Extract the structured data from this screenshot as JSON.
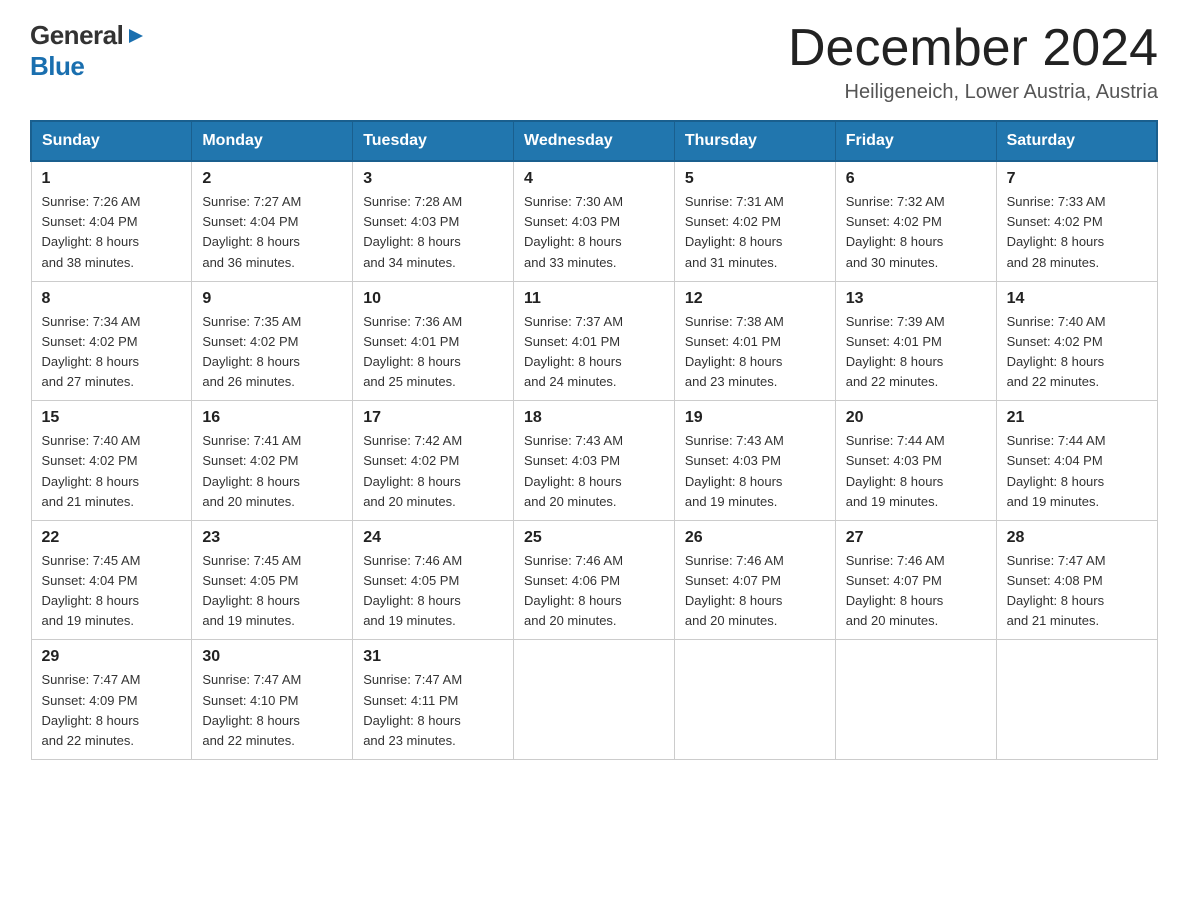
{
  "logo": {
    "general": "General",
    "blue": "Blue"
  },
  "title": {
    "month_year": "December 2024",
    "location": "Heiligeneich, Lower Austria, Austria"
  },
  "weekdays": [
    "Sunday",
    "Monday",
    "Tuesday",
    "Wednesday",
    "Thursday",
    "Friday",
    "Saturday"
  ],
  "weeks": [
    [
      {
        "day": "1",
        "sunrise": "7:26 AM",
        "sunset": "4:04 PM",
        "daylight": "8 hours and 38 minutes."
      },
      {
        "day": "2",
        "sunrise": "7:27 AM",
        "sunset": "4:04 PM",
        "daylight": "8 hours and 36 minutes."
      },
      {
        "day": "3",
        "sunrise": "7:28 AM",
        "sunset": "4:03 PM",
        "daylight": "8 hours and 34 minutes."
      },
      {
        "day": "4",
        "sunrise": "7:30 AM",
        "sunset": "4:03 PM",
        "daylight": "8 hours and 33 minutes."
      },
      {
        "day": "5",
        "sunrise": "7:31 AM",
        "sunset": "4:02 PM",
        "daylight": "8 hours and 31 minutes."
      },
      {
        "day": "6",
        "sunrise": "7:32 AM",
        "sunset": "4:02 PM",
        "daylight": "8 hours and 30 minutes."
      },
      {
        "day": "7",
        "sunrise": "7:33 AM",
        "sunset": "4:02 PM",
        "daylight": "8 hours and 28 minutes."
      }
    ],
    [
      {
        "day": "8",
        "sunrise": "7:34 AM",
        "sunset": "4:02 PM",
        "daylight": "8 hours and 27 minutes."
      },
      {
        "day": "9",
        "sunrise": "7:35 AM",
        "sunset": "4:02 PM",
        "daylight": "8 hours and 26 minutes."
      },
      {
        "day": "10",
        "sunrise": "7:36 AM",
        "sunset": "4:01 PM",
        "daylight": "8 hours and 25 minutes."
      },
      {
        "day": "11",
        "sunrise": "7:37 AM",
        "sunset": "4:01 PM",
        "daylight": "8 hours and 24 minutes."
      },
      {
        "day": "12",
        "sunrise": "7:38 AM",
        "sunset": "4:01 PM",
        "daylight": "8 hours and 23 minutes."
      },
      {
        "day": "13",
        "sunrise": "7:39 AM",
        "sunset": "4:01 PM",
        "daylight": "8 hours and 22 minutes."
      },
      {
        "day": "14",
        "sunrise": "7:40 AM",
        "sunset": "4:02 PM",
        "daylight": "8 hours and 22 minutes."
      }
    ],
    [
      {
        "day": "15",
        "sunrise": "7:40 AM",
        "sunset": "4:02 PM",
        "daylight": "8 hours and 21 minutes."
      },
      {
        "day": "16",
        "sunrise": "7:41 AM",
        "sunset": "4:02 PM",
        "daylight": "8 hours and 20 minutes."
      },
      {
        "day": "17",
        "sunrise": "7:42 AM",
        "sunset": "4:02 PM",
        "daylight": "8 hours and 20 minutes."
      },
      {
        "day": "18",
        "sunrise": "7:43 AM",
        "sunset": "4:03 PM",
        "daylight": "8 hours and 20 minutes."
      },
      {
        "day": "19",
        "sunrise": "7:43 AM",
        "sunset": "4:03 PM",
        "daylight": "8 hours and 19 minutes."
      },
      {
        "day": "20",
        "sunrise": "7:44 AM",
        "sunset": "4:03 PM",
        "daylight": "8 hours and 19 minutes."
      },
      {
        "day": "21",
        "sunrise": "7:44 AM",
        "sunset": "4:04 PM",
        "daylight": "8 hours and 19 minutes."
      }
    ],
    [
      {
        "day": "22",
        "sunrise": "7:45 AM",
        "sunset": "4:04 PM",
        "daylight": "8 hours and 19 minutes."
      },
      {
        "day": "23",
        "sunrise": "7:45 AM",
        "sunset": "4:05 PM",
        "daylight": "8 hours and 19 minutes."
      },
      {
        "day": "24",
        "sunrise": "7:46 AM",
        "sunset": "4:05 PM",
        "daylight": "8 hours and 19 minutes."
      },
      {
        "day": "25",
        "sunrise": "7:46 AM",
        "sunset": "4:06 PM",
        "daylight": "8 hours and 20 minutes."
      },
      {
        "day": "26",
        "sunrise": "7:46 AM",
        "sunset": "4:07 PM",
        "daylight": "8 hours and 20 minutes."
      },
      {
        "day": "27",
        "sunrise": "7:46 AM",
        "sunset": "4:07 PM",
        "daylight": "8 hours and 20 minutes."
      },
      {
        "day": "28",
        "sunrise": "7:47 AM",
        "sunset": "4:08 PM",
        "daylight": "8 hours and 21 minutes."
      }
    ],
    [
      {
        "day": "29",
        "sunrise": "7:47 AM",
        "sunset": "4:09 PM",
        "daylight": "8 hours and 22 minutes."
      },
      {
        "day": "30",
        "sunrise": "7:47 AM",
        "sunset": "4:10 PM",
        "daylight": "8 hours and 22 minutes."
      },
      {
        "day": "31",
        "sunrise": "7:47 AM",
        "sunset": "4:11 PM",
        "daylight": "8 hours and 23 minutes."
      },
      null,
      null,
      null,
      null
    ]
  ],
  "labels": {
    "sunrise": "Sunrise:",
    "sunset": "Sunset:",
    "daylight": "Daylight:"
  }
}
